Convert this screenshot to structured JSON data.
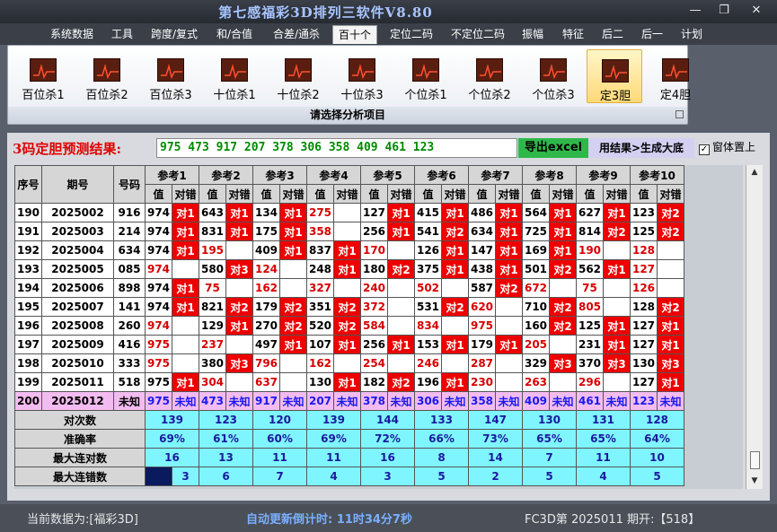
{
  "window": {
    "title": "第七感福彩3D排列三软件V8.80",
    "minimize": "—",
    "restore": "❐",
    "close": "✕"
  },
  "menu": [
    "系统数据",
    "工具",
    "跨度/复式",
    "和/合值",
    "合差/通杀",
    "百十个",
    "定位二码",
    "不定位二码",
    "振幅",
    "特征",
    "后二",
    "后一",
    "计划"
  ],
  "active_menu_index": 5,
  "ribbon": {
    "buttons": [
      "百位杀1",
      "百位杀2",
      "百位杀3",
      "十位杀1",
      "十位杀2",
      "十位杀3",
      "个位杀1",
      "个位杀2",
      "个位杀3",
      "定3胆",
      "定4胆"
    ],
    "active_index": 9,
    "caption": "请选择分析项目"
  },
  "prediction": {
    "label": "3码定胆预测结果:",
    "value": "975 473 917 207 378 306 358 409 461 123",
    "export_label": "导出excel",
    "generate_label": "用结果>生成大底",
    "ontop_label": "窗体置上",
    "ontop_checked": true
  },
  "grid": {
    "col_headers": [
      "序号",
      "期号",
      "号码"
    ],
    "group_headers": [
      "参考1",
      "参考2",
      "参考3",
      "参考4",
      "参考5",
      "参考6",
      "参考7",
      "参考8",
      "参考9",
      "参考10"
    ],
    "sub_headers": [
      "值",
      "对错"
    ],
    "rows": [
      {
        "seq": "190",
        "period": "2025002",
        "num": "916",
        "cells": [
          [
            "974",
            "p",
            "对1"
          ],
          [
            "643",
            "p",
            "对1"
          ],
          [
            "134",
            "p",
            "对1"
          ],
          [
            "275",
            "r",
            ""
          ],
          [
            "127",
            "p",
            "对1"
          ],
          [
            "415",
            "p",
            "对1"
          ],
          [
            "486",
            "p",
            "对1"
          ],
          [
            "564",
            "p",
            "对1"
          ],
          [
            "627",
            "p",
            "对1"
          ],
          [
            "123",
            "p",
            "对2"
          ]
        ]
      },
      {
        "seq": "191",
        "period": "2025003",
        "num": "214",
        "cells": [
          [
            "974",
            "p",
            "对1"
          ],
          [
            "831",
            "p",
            "对1"
          ],
          [
            "175",
            "p",
            "对1"
          ],
          [
            "358",
            "r",
            ""
          ],
          [
            "256",
            "p",
            "对1"
          ],
          [
            "541",
            "p",
            "对2"
          ],
          [
            "634",
            "p",
            "对1"
          ],
          [
            "725",
            "p",
            "对1"
          ],
          [
            "814",
            "p",
            "对2"
          ],
          [
            "125",
            "p",
            "对2"
          ]
        ]
      },
      {
        "seq": "192",
        "period": "2025004",
        "num": "634",
        "cells": [
          [
            "974",
            "p",
            "对1"
          ],
          [
            "195",
            "r",
            ""
          ],
          [
            "409",
            "p",
            "对1"
          ],
          [
            "837",
            "p",
            "对1"
          ],
          [
            "170",
            "r",
            ""
          ],
          [
            "126",
            "p",
            "对1"
          ],
          [
            "147",
            "p",
            "对1"
          ],
          [
            "169",
            "p",
            "对1"
          ],
          [
            "190",
            "r",
            ""
          ],
          [
            "128",
            "r",
            ""
          ]
        ]
      },
      {
        "seq": "193",
        "period": "2025005",
        "num": "085",
        "cells": [
          [
            "974",
            "r",
            ""
          ],
          [
            "580",
            "p",
            "对3"
          ],
          [
            "124",
            "r",
            ""
          ],
          [
            "248",
            "p",
            "对1"
          ],
          [
            "180",
            "p",
            "对2"
          ],
          [
            "375",
            "p",
            "对1"
          ],
          [
            "438",
            "p",
            "对1"
          ],
          [
            "501",
            "p",
            "对2"
          ],
          [
            "562",
            "p",
            "对1"
          ],
          [
            "127",
            "r",
            ""
          ]
        ]
      },
      {
        "seq": "194",
        "period": "2025006",
        "num": "898",
        "cells": [
          [
            "974",
            "p",
            "对1"
          ],
          [
            "75",
            "r",
            ""
          ],
          [
            "162",
            "r",
            ""
          ],
          [
            "327",
            "r",
            ""
          ],
          [
            "240",
            "r",
            ""
          ],
          [
            "502",
            "r",
            ""
          ],
          [
            "587",
            "p",
            "对2"
          ],
          [
            "672",
            "r",
            ""
          ],
          [
            "75",
            "r",
            ""
          ],
          [
            "126",
            "r",
            ""
          ]
        ]
      },
      {
        "seq": "195",
        "period": "2025007",
        "num": "141",
        "cells": [
          [
            "974",
            "p",
            "对1"
          ],
          [
            "821",
            "p",
            "对2"
          ],
          [
            "179",
            "p",
            "对2"
          ],
          [
            "351",
            "p",
            "对2"
          ],
          [
            "372",
            "r",
            ""
          ],
          [
            "531",
            "p",
            "对2"
          ],
          [
            "620",
            "r",
            ""
          ],
          [
            "710",
            "p",
            "对2"
          ],
          [
            "805",
            "r",
            ""
          ],
          [
            "128",
            "p",
            "对2"
          ]
        ]
      },
      {
        "seq": "196",
        "period": "2025008",
        "num": "260",
        "cells": [
          [
            "974",
            "r",
            ""
          ],
          [
            "129",
            "p",
            "对1"
          ],
          [
            "270",
            "p",
            "对2"
          ],
          [
            "520",
            "p",
            "对2"
          ],
          [
            "584",
            "r",
            ""
          ],
          [
            "834",
            "r",
            ""
          ],
          [
            "975",
            "r",
            ""
          ],
          [
            "160",
            "p",
            "对2"
          ],
          [
            "125",
            "p",
            "对1"
          ],
          [
            "127",
            "p",
            "对1"
          ]
        ]
      },
      {
        "seq": "197",
        "period": "2025009",
        "num": "416",
        "cells": [
          [
            "975",
            "r",
            ""
          ],
          [
            "237",
            "r",
            ""
          ],
          [
            "497",
            "p",
            "对1"
          ],
          [
            "107",
            "p",
            "对1"
          ],
          [
            "256",
            "p",
            "对1"
          ],
          [
            "153",
            "p",
            "对1"
          ],
          [
            "179",
            "p",
            "对1"
          ],
          [
            "205",
            "r",
            ""
          ],
          [
            "231",
            "p",
            "对1"
          ],
          [
            "127",
            "p",
            "对1"
          ]
        ]
      },
      {
        "seq": "198",
        "period": "2025010",
        "num": "333",
        "cells": [
          [
            "975",
            "r",
            ""
          ],
          [
            "380",
            "p",
            "对3"
          ],
          [
            "796",
            "r",
            ""
          ],
          [
            "162",
            "r",
            ""
          ],
          [
            "254",
            "r",
            ""
          ],
          [
            "246",
            "r",
            ""
          ],
          [
            "287",
            "r",
            ""
          ],
          [
            "329",
            "p",
            "对3"
          ],
          [
            "370",
            "p",
            "对3"
          ],
          [
            "130",
            "p",
            "对3"
          ]
        ]
      },
      {
        "seq": "199",
        "period": "2025011",
        "num": "518",
        "cells": [
          [
            "975",
            "p",
            "对1"
          ],
          [
            "304",
            "r",
            ""
          ],
          [
            "637",
            "r",
            ""
          ],
          [
            "130",
            "p",
            "对1"
          ],
          [
            "182",
            "p",
            "对2"
          ],
          [
            "196",
            "p",
            "对1"
          ],
          [
            "230",
            "r",
            ""
          ],
          [
            "263",
            "r",
            ""
          ],
          [
            "296",
            "r",
            ""
          ],
          [
            "127",
            "p",
            "对1"
          ]
        ]
      }
    ],
    "last_row": {
      "seq": "200",
      "period": "2025012",
      "num": "未知",
      "values": [
        "975",
        "473",
        "917",
        "207",
        "378",
        "306",
        "358",
        "409",
        "461",
        "123"
      ],
      "status": "未知"
    },
    "stats": [
      {
        "label": "对次数",
        "values": [
          "139",
          "123",
          "120",
          "139",
          "144",
          "133",
          "147",
          "130",
          "131",
          "128"
        ]
      },
      {
        "label": "准确率",
        "values": [
          "69%",
          "61%",
          "60%",
          "69%",
          "72%",
          "66%",
          "73%",
          "65%",
          "65%",
          "64%"
        ]
      },
      {
        "label": "最大连对数",
        "values": [
          "16",
          "13",
          "11",
          "11",
          "16",
          "8",
          "14",
          "7",
          "11",
          "10"
        ]
      },
      {
        "label": "最大连错数",
        "values": [
          "3",
          "6",
          "7",
          "4",
          "3",
          "5",
          "2",
          "5",
          "4",
          "5"
        ]
      }
    ]
  },
  "status": {
    "current_data": "当前数据为:[福彩3D]",
    "countdown": "自动更新倒计时:  11时34分7秒",
    "issue": "FC3D第 2025011 期开:【518】"
  },
  "colors": {
    "hit": "#ee0000",
    "stat_bg": "#7ff6ff",
    "last_row_bg": "#f3bcf0",
    "predict_text": "#008a00",
    "title": "#a8c4ff"
  }
}
